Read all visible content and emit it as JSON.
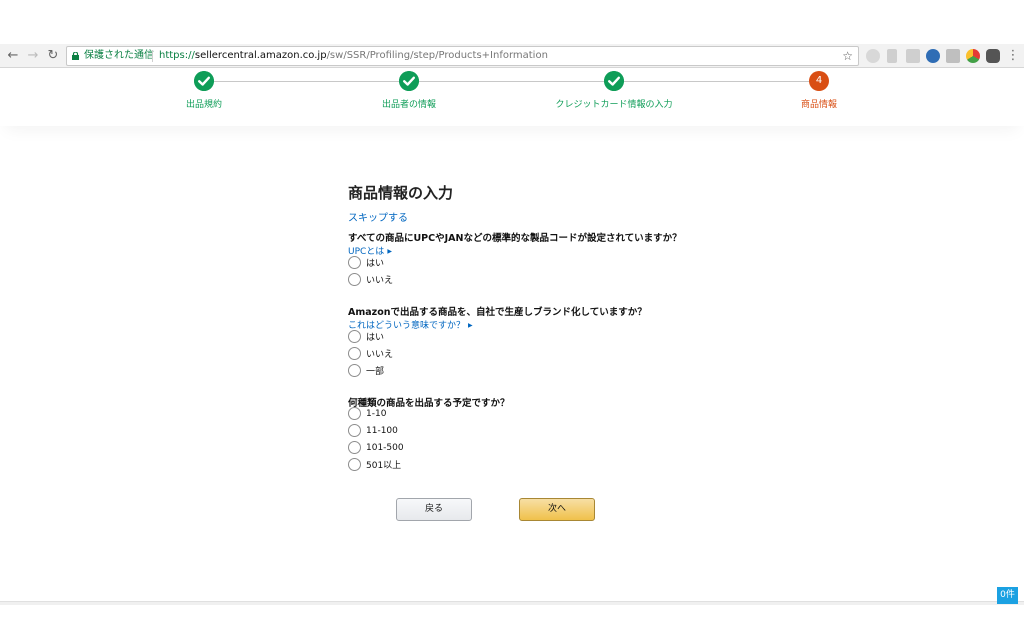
{
  "browser": {
    "secure_label": "保護された通信",
    "url_scheme": "https://",
    "url_host": "sellercentral.amazon.co.jp",
    "url_path": "/sw/SSR/Profiling/step/Products+Information"
  },
  "stepper": {
    "steps": [
      {
        "label": "出品規約",
        "state": "done"
      },
      {
        "label": "出品者の情報",
        "state": "done"
      },
      {
        "label": "クレジットカード情報の入力",
        "state": "done"
      },
      {
        "label": "商品情報",
        "state": "current",
        "number": "4"
      }
    ],
    "colors": {
      "done": "#0f9d58",
      "current": "#d94e13"
    }
  },
  "form": {
    "title": "商品情報の入力",
    "skip_link": "スキップする",
    "q1": {
      "text": "すべての商品にUPCやJANなどの標準的な製品コードが設定されていますか？",
      "help": "UPCとは",
      "options": [
        "はい",
        "いいえ"
      ]
    },
    "q2": {
      "text": "Amazonで出品する商品を、自社で生産しブランド化していますか？",
      "help": "これはどういう意味ですか？",
      "options": [
        "はい",
        "いいえ",
        "一部"
      ]
    },
    "q3": {
      "text": "何種類の商品を出品する予定ですか？",
      "options": [
        "1-10",
        "11-100",
        "101-500",
        "501以上"
      ]
    }
  },
  "buttons": {
    "back": "戻る",
    "next": "次へ"
  },
  "badge": {
    "count": "0件"
  }
}
